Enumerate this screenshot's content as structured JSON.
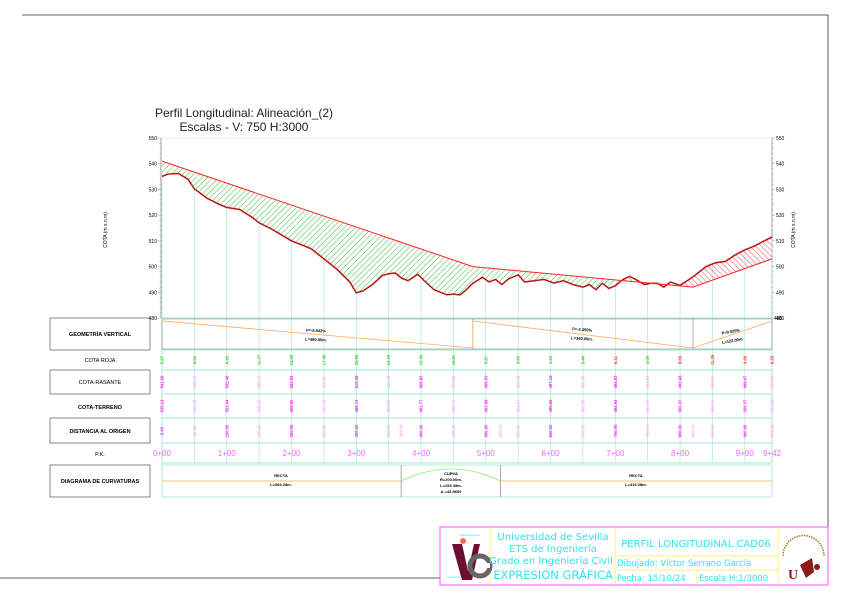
{
  "title": {
    "line1": "Perfil Longitudinal: Alineación_(2)",
    "line2": "Escalas - V: 750 H:3000"
  },
  "axis": {
    "ylabel": "COTA (m s.n.m)",
    "yticks": [
      550,
      540,
      530,
      520,
      510,
      500,
      490,
      480
    ]
  },
  "colors": {
    "grid": "#9fe8cf",
    "rasante": "#ff2222",
    "terreno": "#222222",
    "desmonte": "#22bb22",
    "terraplen": "#ff3333",
    "pk": "#ff66ff",
    "geometry": "#ffaa55"
  },
  "chart_data": {
    "type": "line",
    "xlabel": "P.K. (m)",
    "ylabel": "COTA (m s.n.m)",
    "xlim": [
      0,
      942
    ],
    "ylim": [
      480,
      550
    ],
    "series": [
      {
        "name": "Rasante",
        "x": [
          0,
          480,
          820,
          942
        ],
        "y": [
          541.0,
          500.0,
          492.0,
          503.0
        ]
      },
      {
        "name": "Terreno",
        "x": [
          0,
          10,
          25,
          40,
          50,
          70,
          90,
          100,
          120,
          140,
          150,
          170,
          200,
          230,
          250,
          270,
          290,
          300,
          310,
          325,
          340,
          350,
          360,
          370,
          380,
          395,
          405,
          420,
          440,
          450,
          460,
          470,
          480,
          495,
          505,
          515,
          525,
          535,
          550,
          560,
          575,
          590,
          605,
          620,
          635,
          650,
          660,
          670,
          680,
          690,
          700,
          712,
          722,
          735,
          745,
          755,
          765,
          775,
          785,
          800,
          820,
          840,
          855,
          870,
          885,
          900,
          915,
          930,
          942
        ],
        "y": [
          535.1,
          536.0,
          536.2,
          534.0,
          530.2,
          526.5,
          524.0,
          523.0,
          522.2,
          519.0,
          517.0,
          514.5,
          510.0,
          507.0,
          503.0,
          499.0,
          494.0,
          489.8,
          490.5,
          493.0,
          496.5,
          497.2,
          497.5,
          495.5,
          494.5,
          497.0,
          494.5,
          491.0,
          489.0,
          489.3,
          489.0,
          491.0,
          493.5,
          495.8,
          494.0,
          495.0,
          493.0,
          495.2,
          496.8,
          494.0,
          494.5,
          495.0,
          493.6,
          494.5,
          493.0,
          492.0,
          493.0,
          491.0,
          493.5,
          491.5,
          492.5,
          495.0,
          496.2,
          494.5,
          493.0,
          493.5,
          493.5,
          492.0,
          494.0,
          492.7,
          496.0,
          500.0,
          501.5,
          502.0,
          504.5,
          506.5,
          508.0,
          510.0,
          511.5
        ]
      }
    ]
  },
  "table": {
    "labels": {
      "geometria": "GEOMETRÍA VERTICAL",
      "cota_roja": "COTA ROJA",
      "cota_rasante": "COTA-RASANTE",
      "cota_terreno": "COTA-TERRENO",
      "distancia": "DISTANCIA AL ORIGEN",
      "pk": "P.K.",
      "curvaturas": "DIAGRAMA DE CURVATURAS"
    },
    "vertical_geometry": [
      {
        "grade": "P=-8.542%",
        "length": "L=480.00m."
      },
      {
        "grade": "P=-2.350%",
        "length": "L=340.00m."
      },
      {
        "grade": "P=9.020%",
        "length": "L=122.00m."
      }
    ],
    "stations": [
      0,
      50,
      100,
      150,
      200,
      250,
      300,
      350,
      400,
      450,
      500,
      550,
      600,
      650,
      700,
      750,
      800,
      850,
      900,
      942
    ],
    "cota_roja": [
      "5.87",
      "6.54",
      "9.42",
      "11.27",
      "14.02",
      "17.49",
      "25.65",
      "14.19",
      "15.06",
      "15.81",
      "5.87",
      "3.69",
      "1.53",
      "5.46",
      "6.11",
      "2.09",
      "8.69",
      "11.39",
      "9.89",
      "8.29"
    ],
    "cota_roja_red": [
      false,
      false,
      false,
      false,
      false,
      false,
      false,
      false,
      false,
      false,
      false,
      false,
      false,
      false,
      true,
      false,
      true,
      true,
      true,
      true
    ],
    "cota_rasante": [
      "541.00",
      "536.73",
      "532.46",
      "528.19",
      "523.92",
      "519.65",
      "515.38",
      "511.10",
      "506.83",
      "502.56",
      "499.53",
      "498.36",
      "497.18",
      "496.00",
      "494.83",
      "493.65",
      "492.48",
      "494.96",
      "499.47",
      "504.20"
    ],
    "cota_terreno": [
      "535.13",
      "530.19",
      "523.04",
      "516.92",
      "509.90",
      "502.16",
      "489.73",
      "496.92",
      "491.77",
      "486.75",
      "493.66",
      "494.67",
      "495.65",
      "490.55",
      "494.94",
      "491.57",
      "500.37",
      "506.35",
      "509.37",
      "512.29"
    ],
    "distancia": [
      {
        "pk": 0,
        "v": "0.00"
      },
      {
        "pk": 50,
        "v": "50.00"
      },
      {
        "pk": 100,
        "v": "100.00"
      },
      {
        "pk": 150,
        "v": "150.00"
      },
      {
        "pk": 200,
        "v": "200.00"
      },
      {
        "pk": 250,
        "v": "250.00"
      },
      {
        "pk": 300,
        "v": "300.00"
      },
      {
        "pk": 350,
        "v": "350.00"
      },
      {
        "pk": 369.28,
        "v": "369.28"
      },
      {
        "pk": 400,
        "v": "400.00"
      },
      {
        "pk": 450,
        "v": "450.00"
      },
      {
        "pk": 500,
        "v": "500.00"
      },
      {
        "pk": 522.73,
        "v": "522.73"
      },
      {
        "pk": 550,
        "v": "550.00"
      },
      {
        "pk": 600,
        "v": "600.00"
      },
      {
        "pk": 650,
        "v": "650.00"
      },
      {
        "pk": 700,
        "v": "700.00"
      },
      {
        "pk": 750,
        "v": "750.00"
      },
      {
        "pk": 800,
        "v": "800.00"
      },
      {
        "pk": 820,
        "v": "820.00"
      },
      {
        "pk": 850,
        "v": "850.00"
      },
      {
        "pk": 900,
        "v": "900.00"
      },
      {
        "pk": 942,
        "v": "942.01"
      }
    ],
    "pk_labels": [
      {
        "pk": 0,
        "v": "0+00"
      },
      {
        "pk": 100,
        "v": "1+00"
      },
      {
        "pk": 200,
        "v": "2+00"
      },
      {
        "pk": 300,
        "v": "3+00"
      },
      {
        "pk": 400,
        "v": "4+00"
      },
      {
        "pk": 500,
        "v": "5+00"
      },
      {
        "pk": 600,
        "v": "6+00"
      },
      {
        "pk": 700,
        "v": "7+00"
      },
      {
        "pk": 800,
        "v": "8+00"
      },
      {
        "pk": 900,
        "v": "9+00"
      },
      {
        "pk": 942,
        "v": "9+42"
      }
    ],
    "curvatures": {
      "recta1": {
        "type": "RECTA",
        "length": "L=369.28m."
      },
      "curva": {
        "type": "CURVA",
        "radius": "R=200.00m.",
        "length": "L=153.45m.",
        "delta": "Δ =43.9600"
      },
      "recta2": {
        "type": "RECTA",
        "length": "L=419.28m."
      }
    }
  },
  "title_block": {
    "dept_logo_text": [
      "Departamento de",
      "Ingeniería Gráfica"
    ],
    "university": "Universidad de Sevilla",
    "school": "ETS de Ingeniería",
    "degree": "Grado en Ingeniería Civil",
    "subject": "EXPRESIÓN GRÁFICA",
    "drawing_title": "PERFIL LONGITUDINAL CAD06",
    "drawn_by": "Dibujado: Víctor Serrano García",
    "date": "Fecha: 15/10/24",
    "scale": "Escala H:1/3000",
    "seal_text": "UNIVERSIDAD DE SEVILLA"
  }
}
